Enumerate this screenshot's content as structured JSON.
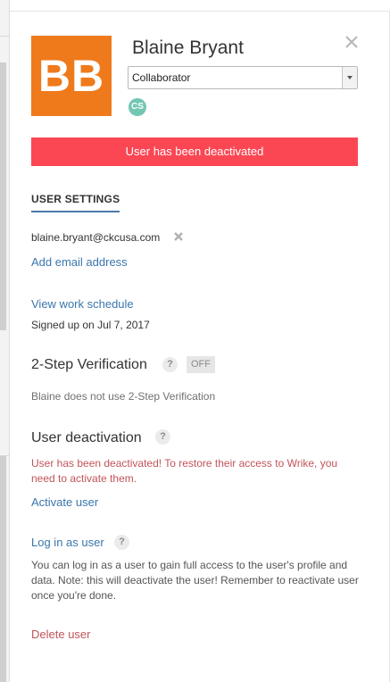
{
  "user": {
    "initials": "BB",
    "name": "Blaine Bryant",
    "role": "Collaborator",
    "badge": "CS",
    "avatar_color": "#ef7a1b",
    "badge_color": "#72c7b4"
  },
  "alert": {
    "message": "User has been deactivated",
    "color": "#fb4754"
  },
  "settings": {
    "tab_label": "USER SETTINGS",
    "email": "blaine.bryant@ckcusa.com",
    "add_email_label": "Add email address",
    "view_schedule_label": "View work schedule",
    "signed_up_text": "Signed up on Jul 7, 2017"
  },
  "two_step": {
    "title": "2-Step Verification",
    "help": "?",
    "status": "OFF",
    "description": "Blaine does not use 2-Step Verification"
  },
  "deactivation": {
    "title": "User deactivation",
    "help": "?",
    "warning": "User has been deactivated! To restore their access to Wrike, you need to activate them.",
    "activate_label": "Activate user"
  },
  "login_as": {
    "label": "Log in as user",
    "help": "?",
    "description": "You can log in as a user to gain full access to the user's profile and data. Note: this will deactivate the user! Remember to reactivate user once you're done."
  },
  "delete_label": "Delete user",
  "icons": {
    "close": "close-icon",
    "remove_email": "remove-icon",
    "dropdown": "chevron-down-icon"
  },
  "colors": {
    "link": "#3a76ac",
    "danger": "#c1545a"
  }
}
